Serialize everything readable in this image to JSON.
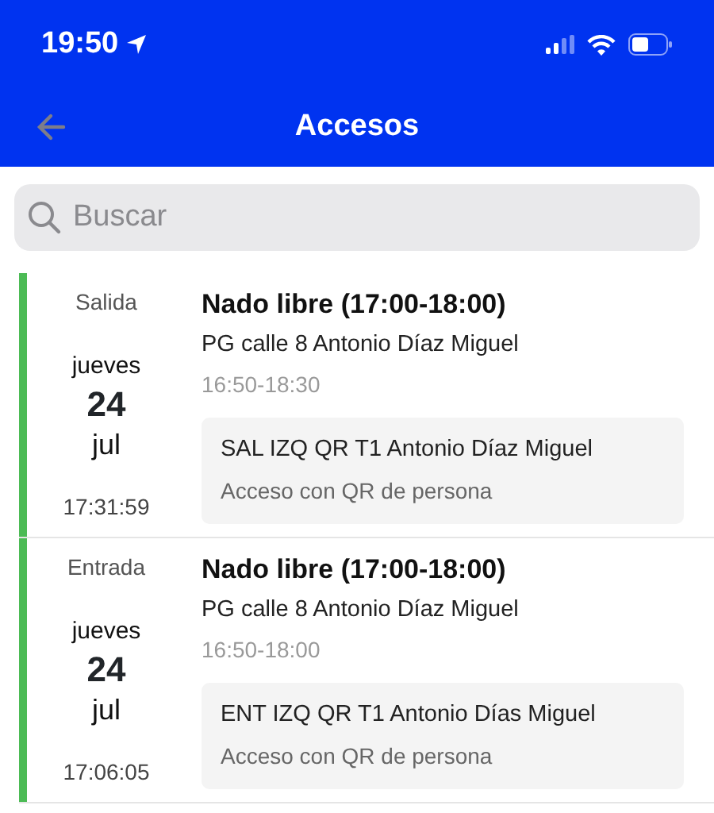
{
  "status_bar": {
    "time": "19:50"
  },
  "header": {
    "title": "Accesos"
  },
  "search": {
    "placeholder": "Buscar"
  },
  "accesses": [
    {
      "direction": "Salida",
      "color": "#4cbb55",
      "weekday": "jueves",
      "day": "24",
      "month": "jul",
      "time": "17:31:59",
      "activity": "Nado libre (17:00-18:00)",
      "place": "PG calle 8 Antonio Díaz Miguel",
      "range": "16:50-18:30",
      "device": "SAL IZQ QR T1 Antonio Díaz Miguel",
      "method": "Acceso con QR de persona"
    },
    {
      "direction": "Entrada",
      "color": "#4cbb55",
      "weekday": "jueves",
      "day": "24",
      "month": "jul",
      "time": "17:06:05",
      "activity": "Nado libre (17:00-18:00)",
      "place": "PG calle 8 Antonio Díaz Miguel",
      "range": "16:50-18:00",
      "device": "ENT IZQ QR T1 Antonio Días Miguel",
      "method": "Acceso con QR de persona"
    }
  ]
}
